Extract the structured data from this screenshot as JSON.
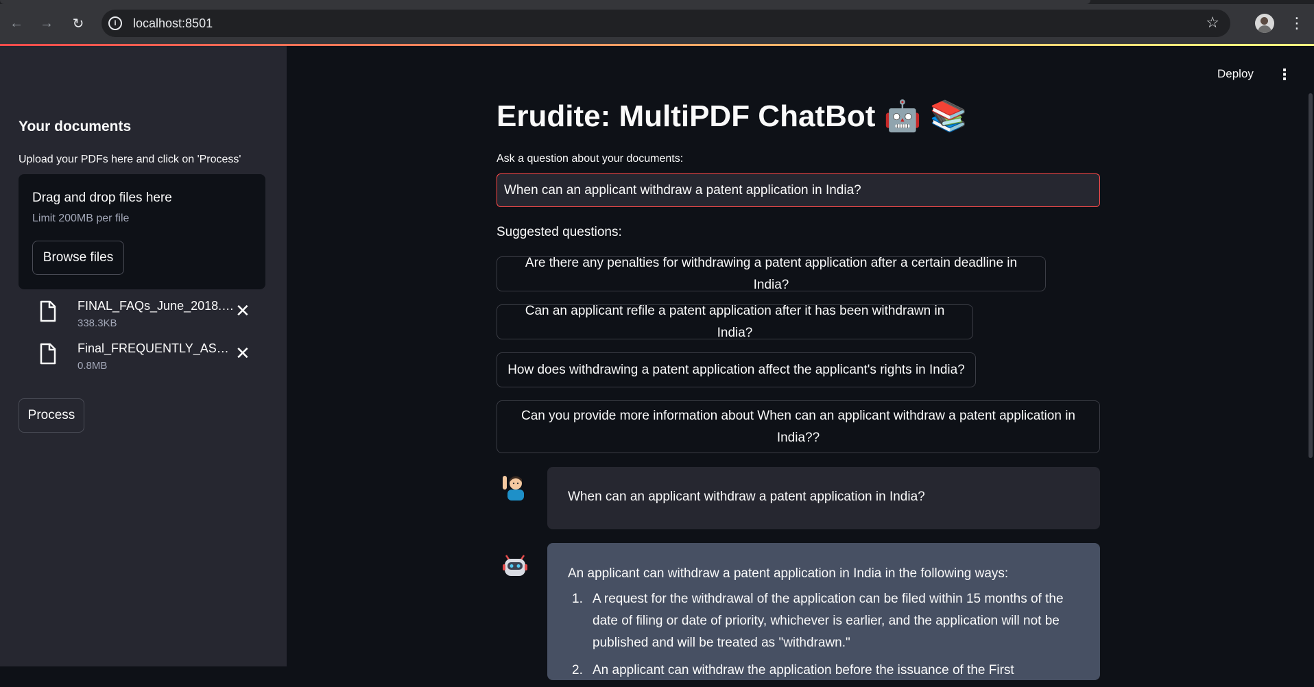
{
  "browser": {
    "url": "localhost:8501"
  },
  "sidebar": {
    "title": "Your documents",
    "subtitle": "Upload your PDFs here and click on 'Process'",
    "dropzone": {
      "title": "Drag and drop files here",
      "limit": "Limit 200MB per file",
      "browse_label": "Browse files"
    },
    "files": [
      {
        "name": "FINAL_FAQs_June_2018.pdf",
        "size": "338.3KB"
      },
      {
        "name": "Final_FREQUENTLY_ASKED_QUESTIONS.pdf",
        "size": "0.8MB"
      }
    ],
    "process_label": "Process"
  },
  "header": {
    "deploy_label": "Deploy"
  },
  "main": {
    "title": "Erudite: MultiPDF ChatBot 🤖 📚",
    "ask_label": "Ask a question about your documents:",
    "question_value": "When can an applicant withdraw a patent application in India?",
    "suggested_label": "Suggested questions:",
    "suggestions": [
      "Are there any penalties for withdrawing a patent application after a certain deadline in India?",
      "Can an applicant refile a patent application after it has been withdrawn in India?",
      "How does withdrawing a patent application affect the applicant's rights in India?",
      "Can you provide more information about When can an applicant withdraw a patent application in India??"
    ],
    "chat": {
      "user_message": "When can an applicant withdraw a patent application in India?",
      "bot_intro": "An applicant can withdraw a patent application in India in the following ways:",
      "bot_points": [
        "A request for the withdrawal of the application can be filed within 15 months of the date of filing or date of priority, whichever is earlier, and the application will not be published and will be treated as \"withdrawn.\"",
        "An applicant can withdraw the application before the issuance of the First"
      ]
    }
  }
}
